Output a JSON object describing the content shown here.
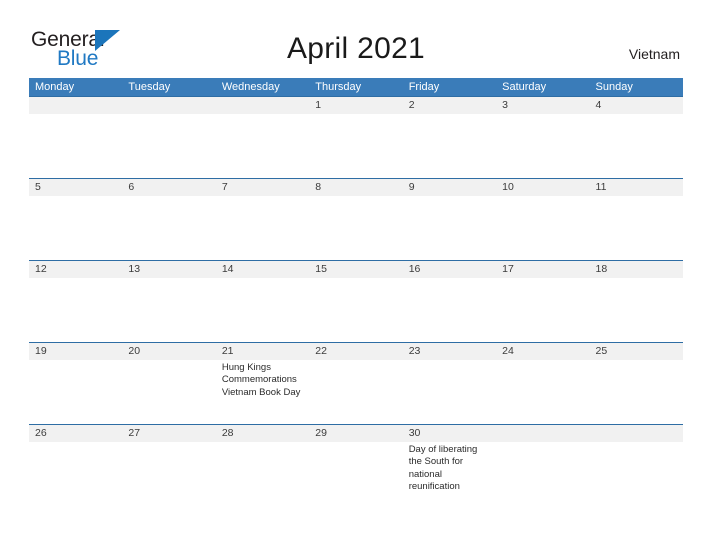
{
  "brand": {
    "name_primary": "General",
    "name_secondary": "Blue",
    "triangle_color": "#1b75bb",
    "secondary_color": "#2079c3"
  },
  "header": {
    "title": "April 2021",
    "region": "Vietnam"
  },
  "theme": {
    "header_blue": "#3a7cb9",
    "row_divider_blue": "#2e6da4",
    "date_band_gray": "#f1f1f1",
    "text_color": "#2b2b2b"
  },
  "calendar": {
    "weekdays": [
      "Monday",
      "Tuesday",
      "Wednesday",
      "Thursday",
      "Friday",
      "Saturday",
      "Sunday"
    ],
    "weeks": [
      {
        "days": [
          {
            "date": "",
            "events": ""
          },
          {
            "date": "",
            "events": ""
          },
          {
            "date": "",
            "events": ""
          },
          {
            "date": "1",
            "events": ""
          },
          {
            "date": "2",
            "events": ""
          },
          {
            "date": "3",
            "events": ""
          },
          {
            "date": "4",
            "events": ""
          }
        ]
      },
      {
        "days": [
          {
            "date": "5",
            "events": ""
          },
          {
            "date": "6",
            "events": ""
          },
          {
            "date": "7",
            "events": ""
          },
          {
            "date": "8",
            "events": ""
          },
          {
            "date": "9",
            "events": ""
          },
          {
            "date": "10",
            "events": ""
          },
          {
            "date": "11",
            "events": ""
          }
        ]
      },
      {
        "days": [
          {
            "date": "12",
            "events": ""
          },
          {
            "date": "13",
            "events": ""
          },
          {
            "date": "14",
            "events": ""
          },
          {
            "date": "15",
            "events": ""
          },
          {
            "date": "16",
            "events": ""
          },
          {
            "date": "17",
            "events": ""
          },
          {
            "date": "18",
            "events": ""
          }
        ]
      },
      {
        "days": [
          {
            "date": "19",
            "events": ""
          },
          {
            "date": "20",
            "events": ""
          },
          {
            "date": "21",
            "events": "Hung Kings Commemorations  Vietnam Book Day"
          },
          {
            "date": "22",
            "events": ""
          },
          {
            "date": "23",
            "events": ""
          },
          {
            "date": "24",
            "events": ""
          },
          {
            "date": "25",
            "events": ""
          }
        ]
      },
      {
        "days": [
          {
            "date": "26",
            "events": ""
          },
          {
            "date": "27",
            "events": ""
          },
          {
            "date": "28",
            "events": ""
          },
          {
            "date": "29",
            "events": ""
          },
          {
            "date": "30",
            "events": "Day of liberating the South for national reunification"
          },
          {
            "date": "",
            "events": ""
          },
          {
            "date": "",
            "events": ""
          }
        ]
      }
    ]
  }
}
